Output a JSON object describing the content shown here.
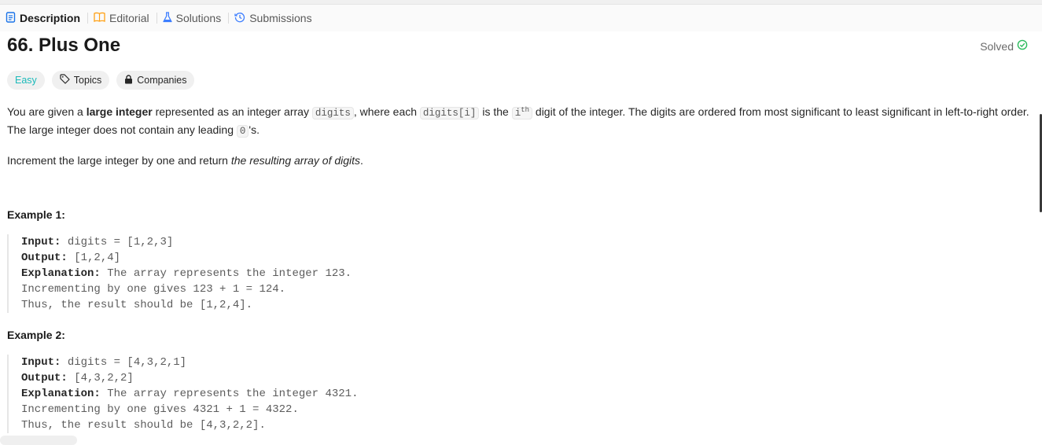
{
  "tabs": [
    {
      "label": "Description",
      "icon": "description-icon",
      "active": true
    },
    {
      "label": "Editorial",
      "icon": "book-icon"
    },
    {
      "label": "Solutions",
      "icon": "flask-icon"
    },
    {
      "label": "Submissions",
      "icon": "history-icon"
    }
  ],
  "problem": {
    "title": "66. Plus One",
    "status": "Solved",
    "tags": {
      "difficulty": "Easy",
      "topics": "Topics",
      "companies": "Companies"
    }
  },
  "description": {
    "s1": "You are given a ",
    "s2": "large integer",
    "s3": " represented as an integer array ",
    "c1": "digits",
    "s4": ", where each ",
    "c2": "digits[i]",
    "s5": " is the ",
    "c3": "i",
    "c3sup": "th",
    "s6": " digit of the integer. The digits are ordered from most significant to least significant in left-to-right order. The large integer does not contain any leading ",
    "c4": "0",
    "s7": "'s.",
    "p2a": "Increment the large integer by one and return ",
    "p2b": "the resulting array of digits",
    "p2c": "."
  },
  "examples": [
    {
      "heading": "Example 1:",
      "input_label": "Input:",
      "input": " digits = [1,2,3]",
      "output_label": "Output:",
      "output": " [1,2,4]",
      "expl_label": "Explanation:",
      "expl1": " The array represents the integer 123.",
      "expl2": "Incrementing by one gives 123 + 1 = 124.",
      "expl3": "Thus, the result should be [1,2,4]."
    },
    {
      "heading": "Example 2:",
      "input_label": "Input:",
      "input": " digits = [4,3,2,1]",
      "output_label": "Output:",
      "output": " [4,3,2,2]",
      "expl_label": "Explanation:",
      "expl1": " The array represents the integer 4321.",
      "expl2": "Incrementing by one gives 4321 + 1 = 4322.",
      "expl3": "Thus, the result should be [4,3,2,2]."
    }
  ],
  "colors": {
    "accent_active": "#1a73e8",
    "easy": "#1cbaba",
    "solved": "#2cbb5d",
    "editorial": "#ffa116"
  }
}
